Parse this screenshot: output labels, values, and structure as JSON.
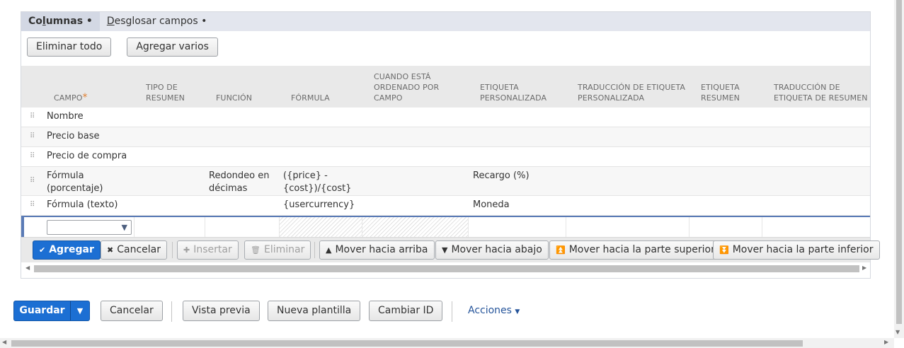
{
  "subtabs": [
    {
      "prefix": "Co",
      "ul": "l",
      "rest": "umnas •"
    },
    {
      "prefix": "",
      "ul": "D",
      "rest": "esglosar campos •"
    }
  ],
  "toolbar": {
    "remove_all": "Eliminar todo",
    "add_multiple": "Agregar varios"
  },
  "columns": {
    "campo": "CAMPO",
    "required_mark": "*",
    "tipo": [
      "TIPO DE",
      "RESUMEN"
    ],
    "funcion": "FUNCIÓN",
    "formula": "FÓRMULA",
    "ordenado": [
      "CUANDO ESTÁ",
      "ORDENADO POR",
      "CAMPO"
    ],
    "etiqueta": [
      "ETIQUETA",
      "PERSONALIZADA"
    ],
    "traduccion": [
      "TRADUCCIÓN DE ETIQUETA",
      "PERSONALIZADA"
    ],
    "etiq_resumen": [
      "ETIQUETA",
      "RESUMEN"
    ],
    "trad_resumen": [
      "TRADUCCIÓN DE",
      "ETIQUETA DE RESUMEN"
    ]
  },
  "rows": [
    {
      "campo": "Nombre",
      "funcion": "",
      "formula": "",
      "etiqueta": ""
    },
    {
      "campo": "Precio base",
      "funcion": "",
      "formula": "",
      "etiqueta": ""
    },
    {
      "campo": "Precio de compra",
      "funcion": "",
      "formula": "",
      "etiqueta": ""
    },
    {
      "campo": [
        "Fórmula",
        "(porcentaje)"
      ],
      "funcion": [
        "Redondeo en",
        "décimas"
      ],
      "formula": [
        "({price} -",
        "{cost})/{cost}"
      ],
      "etiqueta": "Recargo (%)"
    },
    {
      "campo": "Fórmula (texto)",
      "funcion": "",
      "formula": "{usercurrency}",
      "etiqueta": "Moneda"
    }
  ],
  "row_actions": {
    "add": "Agregar",
    "cancel": "Cancelar",
    "insert": "Insertar",
    "delete": "Eliminar",
    "move_up": "Mover hacia arriba",
    "move_down": "Mover hacia abajo",
    "move_top": "Mover hacia la parte superior",
    "move_bottom": "Mover hacia la parte inferior"
  },
  "footer": {
    "save": "Guardar",
    "cancel": "Cancelar",
    "preview": "Vista previa",
    "new_template": "Nueva plantilla",
    "change_id": "Cambiar ID",
    "actions": "Acciones"
  },
  "colors": {
    "primary": "#1c6fd3",
    "link": "#25549a",
    "required": "#e08033",
    "edit_row_border": "#5a7bb6"
  }
}
